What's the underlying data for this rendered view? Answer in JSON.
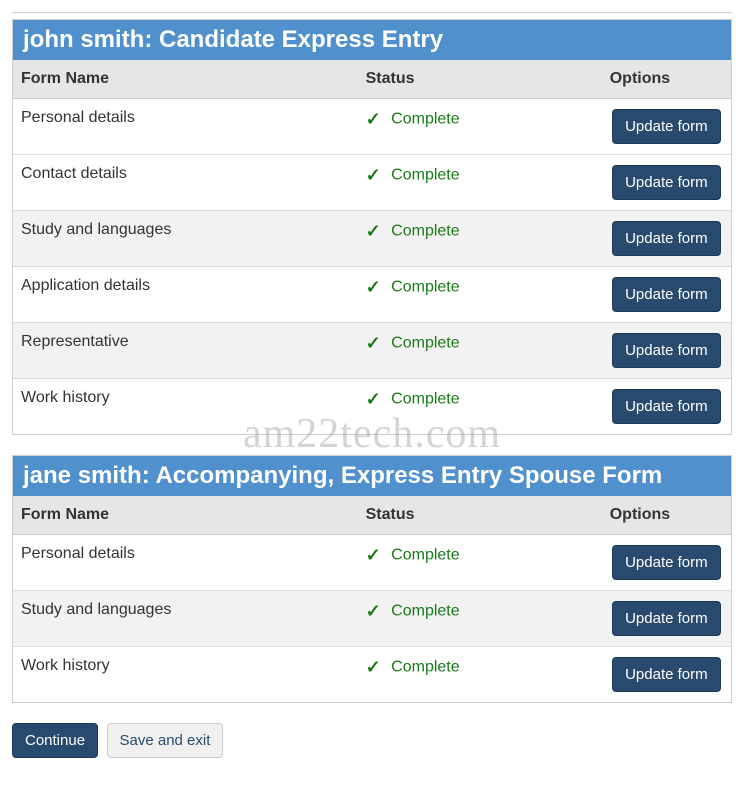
{
  "watermark": "am22tech.com",
  "columns": {
    "name": "Form Name",
    "status": "Status",
    "options": "Options"
  },
  "buttons": {
    "update": "Update form",
    "continue": "Continue",
    "save_exit": "Save and exit"
  },
  "status_complete": "Complete",
  "sections": [
    {
      "title": "john smith: Candidate Express Entry",
      "rows": [
        {
          "name": "Personal details",
          "status": "Complete"
        },
        {
          "name": "Contact details",
          "status": "Complete"
        },
        {
          "name": "Study and languages",
          "status": "Complete"
        },
        {
          "name": "Application details",
          "status": "Complete"
        },
        {
          "name": "Representative",
          "status": "Complete"
        },
        {
          "name": "Work history",
          "status": "Complete"
        }
      ]
    },
    {
      "title": "jane smith: Accompanying, Express Entry Spouse Form",
      "rows": [
        {
          "name": "Personal details",
          "status": "Complete"
        },
        {
          "name": "Study and languages",
          "status": "Complete"
        },
        {
          "name": "Work history",
          "status": "Complete"
        }
      ]
    }
  ]
}
